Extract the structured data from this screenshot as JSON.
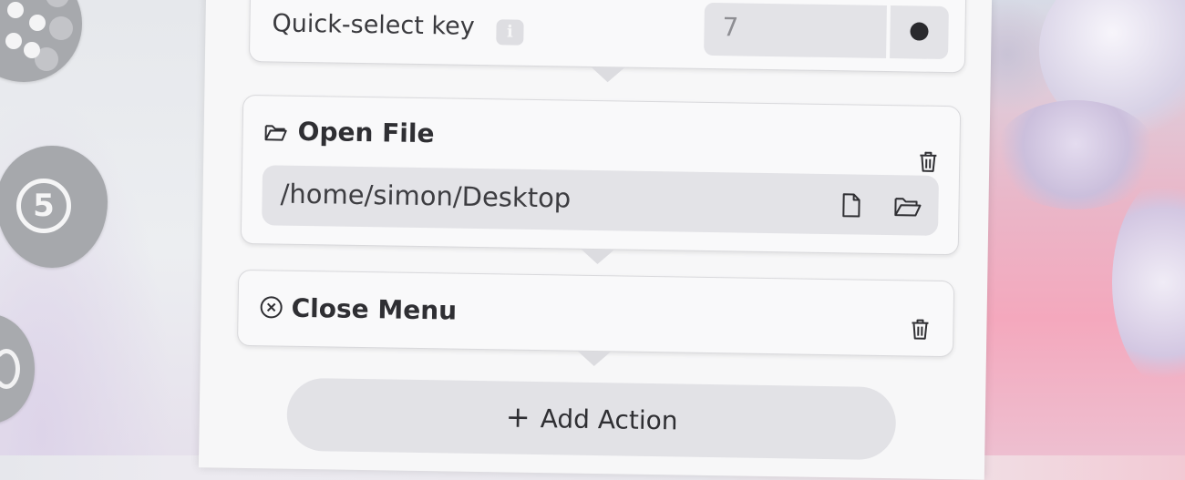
{
  "quick_select": {
    "label": "Quick-select key",
    "info_icon": "info-icon",
    "key_value": "7",
    "record_icon": "record-icon"
  },
  "actions": [
    {
      "title": "Open File",
      "icon": "folder-open-icon",
      "path": "/home/simon/Desktop",
      "buttons": [
        "file-icon",
        "folder-open-icon"
      ],
      "delete_icon": "trash-icon"
    },
    {
      "title": "Close Menu",
      "icon": "close-circle-icon",
      "delete_icon": "trash-icon"
    }
  ],
  "add_action": {
    "label": "Add Action",
    "icon": "plus-icon"
  }
}
